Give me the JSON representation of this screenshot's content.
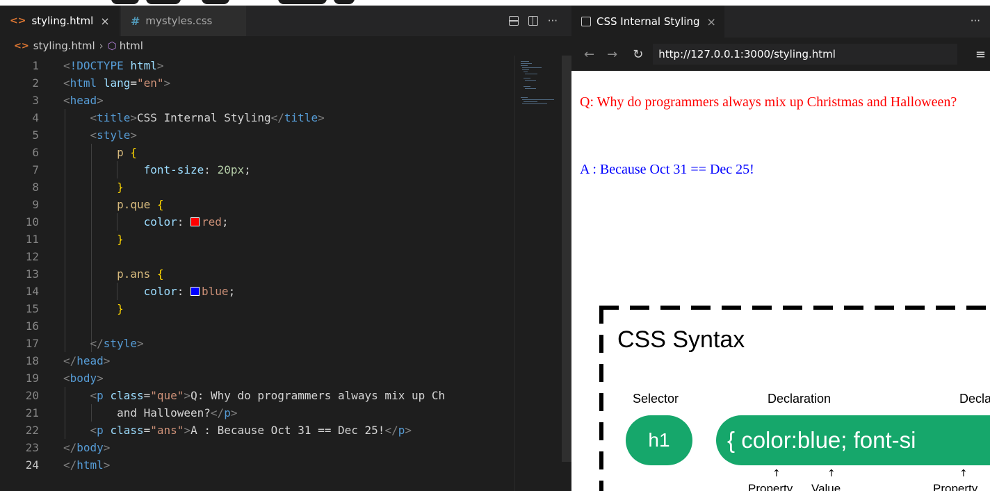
{
  "editor": {
    "tabs": [
      {
        "label": "styling.html",
        "icon": "html-file-icon",
        "close": "×",
        "active": true
      },
      {
        "label": "mystyles.css",
        "icon": "css-file-icon",
        "active": false
      }
    ],
    "actions": {
      "more": "···"
    },
    "breadcrumb": {
      "file": "styling.html",
      "separator": "›",
      "node": "html"
    },
    "current_line": 24
  },
  "browser": {
    "tab": {
      "label": "CSS Internal Styling",
      "close": "×"
    },
    "more": "···",
    "nav": {
      "back": "←",
      "forward": "→",
      "reload": "↻",
      "menu": "≡"
    },
    "url": "http://127.0.0.1:3000/styling.html",
    "page": {
      "question": "Q: Why do programmers always mix up Christmas and Halloween?",
      "answer": "A : Because Oct 31 == Dec 25!"
    },
    "diagram": {
      "title": "CSS Syntax",
      "label_selector": "Selector",
      "label_declaration": "Declaration",
      "label_declaration_2": "Decla",
      "selector": "h1",
      "declaration_block": "{ color:blue; font-si",
      "sub_property": "Property",
      "sub_value": "Value",
      "sub_property_2": "Property"
    }
  },
  "colors": {
    "red_swatch": "#ff0000",
    "blue_swatch": "#0000ff",
    "diagram_green": "#16a76b"
  }
}
